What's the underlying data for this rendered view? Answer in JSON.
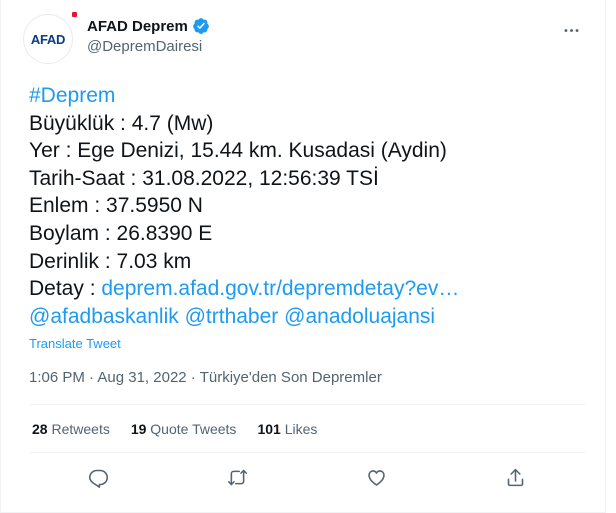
{
  "author": {
    "display_name": "AFAD Deprem",
    "handle": "@DepremDairesi",
    "avatar_text": "AFAD",
    "verified": true
  },
  "tweet": {
    "hashtag": "#Deprem",
    "lines": {
      "magnitude": "Büyüklük : 4.7 (Mw)",
      "location": "Yer : Ege Denizi, 15.44 km. Kusadasi (Aydin)",
      "datetime": "Tarih-Saat : 31.08.2022, 12:56:39 TSİ",
      "latitude": "Enlem : 37.5950 N",
      "longitude": "Boylam : 26.8390 E",
      "depth": "Derinlik : 7.03 km"
    },
    "detail_prefix": "Detay : ",
    "detail_link": "deprem.afad.gov.tr/depremdetay?ev…",
    "mentions": [
      "@afadbaskanlik",
      "@trthaber",
      "@anadoluajansi"
    ]
  },
  "translate_label": "Translate Tweet",
  "meta": {
    "time": "1:06 PM",
    "separator": " · ",
    "date": "Aug 31, 2022",
    "app": "Türkiye'den Son Depremler"
  },
  "stats": {
    "retweets_count": "28",
    "retweets_label": "Retweets",
    "quotes_count": "19",
    "quotes_label": "Quote Tweets",
    "likes_count": "101",
    "likes_label": "Likes"
  },
  "icons": {
    "reply": "reply-icon",
    "retweet": "retweet-icon",
    "like": "like-icon",
    "share": "share-icon",
    "more": "more-icon",
    "verified": "verified-badge-icon"
  },
  "colors": {
    "link": "#1d9bf0",
    "text": "#0f1419",
    "secondary": "#536471"
  }
}
